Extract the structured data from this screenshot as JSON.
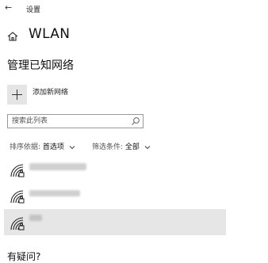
{
  "window": {
    "title": "设置",
    "back_glyph": "←"
  },
  "page": {
    "title": "WLAN"
  },
  "section": {
    "title": "管理已知网络"
  },
  "add_network": {
    "label": "添加新网络"
  },
  "search": {
    "placeholder": "搜索此列表",
    "value": ""
  },
  "sort": {
    "label": "排序依据:",
    "value": "首选项"
  },
  "filter": {
    "label": "筛选条件:",
    "value": "全部"
  },
  "networks": [
    {
      "name": "",
      "selected": false
    },
    {
      "name": "",
      "selected": false
    },
    {
      "name": "",
      "selected": true
    }
  ],
  "footer": {
    "title": "有疑问?"
  },
  "icons": [
    "back-arrow-icon",
    "home-icon",
    "plus-icon",
    "search-icon",
    "chevron-down-icon",
    "wifi-secured-icon"
  ],
  "colors": {
    "selected_row": "#e6e6e6",
    "add_tile": "#e5e5e5"
  }
}
